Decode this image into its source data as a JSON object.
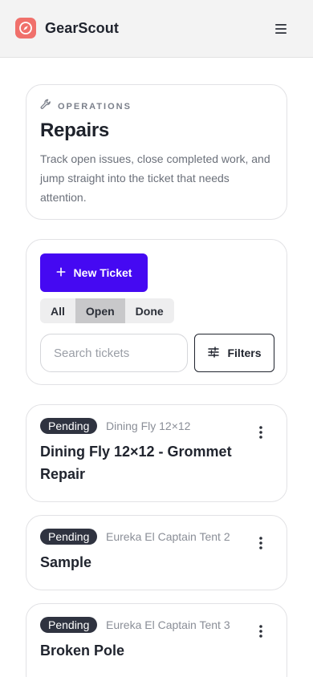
{
  "app": {
    "name": "GearScout",
    "logo_icon": "compass-icon",
    "menu_icon": "hamburger-menu-icon"
  },
  "header_card": {
    "eyebrow": "OPERATIONS",
    "eyebrow_icon": "wrench-icon",
    "title": "Repairs",
    "description": "Track open issues, close completed work, and jump straight into the ticket that needs attention."
  },
  "controls": {
    "new_ticket_label": "New Ticket",
    "segments": [
      "All",
      "Open",
      "Done"
    ],
    "active_segment": "Open",
    "search_placeholder": "Search tickets",
    "filters_label": "Filters"
  },
  "tickets": [
    {
      "status": "Pending",
      "item": "Dining Fly 12×12",
      "title": "Dining Fly 12×12 - Grommet Repair"
    },
    {
      "status": "Pending",
      "item": "Eureka El Captain Tent 2",
      "title": "Sample"
    },
    {
      "status": "Pending",
      "item": "Eureka El Captain Tent 3",
      "title": "Broken Pole"
    }
  ],
  "colors": {
    "accent": "#4509f2",
    "logo": "#f0706b",
    "badge": "#2f3340",
    "topbar": "#f3f3f3"
  }
}
